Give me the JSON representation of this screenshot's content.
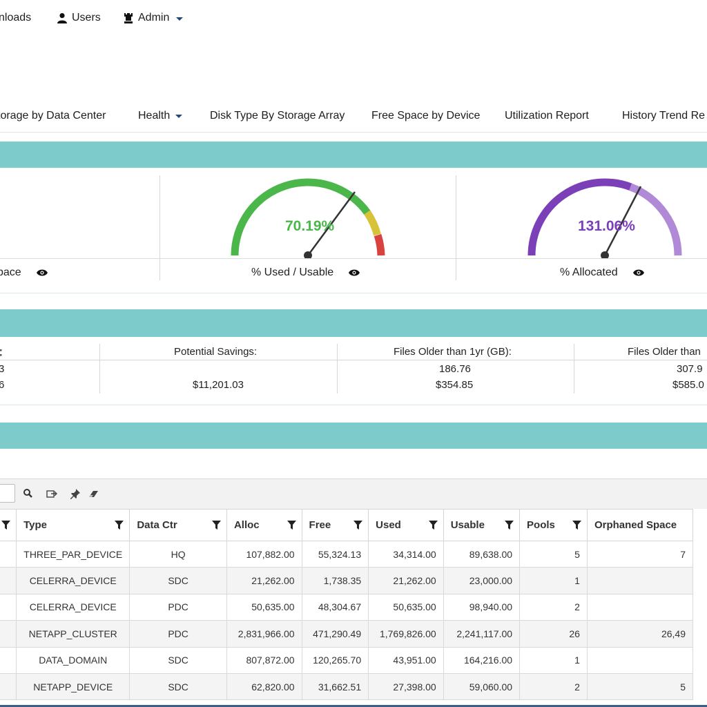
{
  "topnav": {
    "downloads": "nloads",
    "users": "Users",
    "admin": "Admin"
  },
  "subnav": {
    "tabs": [
      "torage by Data Center",
      "Health",
      "Disk Type By Storage Array",
      "Free Space by Device",
      "Utilization Report",
      "History Trend Re"
    ]
  },
  "gauges": {
    "first_caption": "pace",
    "used_usable": {
      "value": "70.19%",
      "percent": 70.19,
      "caption": "% Used / Usable",
      "color": "#4bb74b"
    },
    "allocated": {
      "value": "131.06%",
      "percent": 131.06,
      "caption": "% Allocated",
      "color": "#7b3fb8"
    }
  },
  "savings": {
    "headers": [
      "Potential Savings:",
      "Files Older than 1yr (GB):",
      "Files Older than"
    ],
    "row1": [
      "3",
      "",
      "186.76",
      "307.9"
    ],
    "row2": [
      "6",
      "$11,201.03",
      "$354.85",
      "$585.0"
    ]
  },
  "grid": {
    "columns": [
      "",
      "Type",
      "Data Ctr",
      "Alloc",
      "Free",
      "Used",
      "Usable",
      "Pools",
      "Orphaned Space"
    ],
    "rows": [
      [
        "THREE_PAR_DEVICE",
        "HQ",
        "107,882.00",
        "55,324.13",
        "34,314.00",
        "89,638.00",
        "5",
        "7"
      ],
      [
        "CELERRA_DEVICE",
        "SDC",
        "21,262.00",
        "1,738.35",
        "21,262.00",
        "23,000.00",
        "1",
        ""
      ],
      [
        "CELERRA_DEVICE",
        "PDC",
        "50,635.00",
        "48,304.67",
        "50,635.00",
        "98,940.00",
        "2",
        ""
      ],
      [
        "NETAPP_CLUSTER",
        "PDC",
        "2,831,966.00",
        "471,290.49",
        "1,769,826.00",
        "2,241,117.00",
        "26",
        "26,49"
      ],
      [
        "DATA_DOMAIN",
        "SDC",
        "807,872.00",
        "120,265.70",
        "43,951.00",
        "164,216.00",
        "1",
        ""
      ],
      [
        "NETAPP_DEVICE",
        "SDC",
        "62,820.00",
        "31,662.51",
        "27,398.00",
        "59,060.00",
        "2",
        "5"
      ]
    ]
  },
  "colors": {
    "band": "#7ecbcb",
    "gauge_green": "#4bb74b",
    "gauge_yellow": "#d8c23a",
    "gauge_red": "#d9433f",
    "gauge_purple": "#7b3fb8",
    "gauge_lilac": "#b08ad6"
  }
}
